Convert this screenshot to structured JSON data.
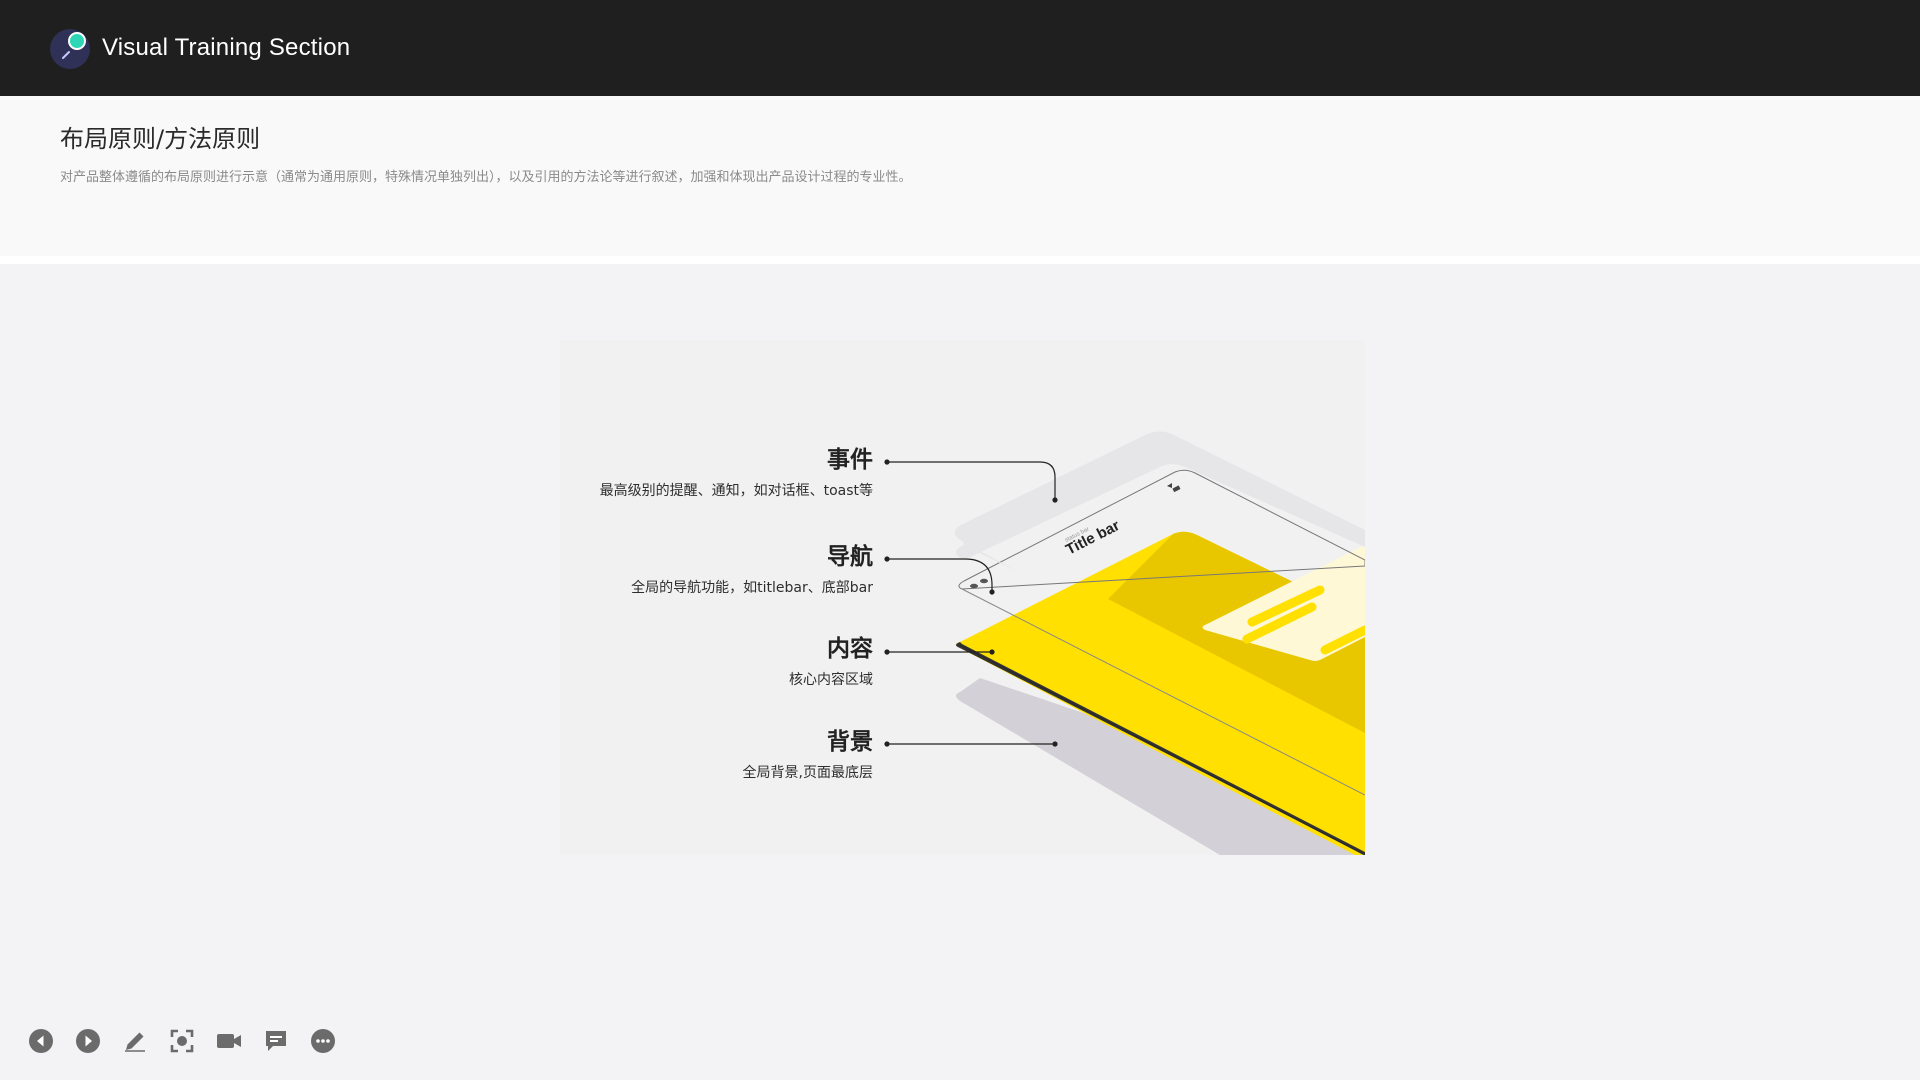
{
  "app": {
    "title": "Visual Training Section"
  },
  "header": {
    "title": "布局原则/方法原则",
    "description": "对产品整体遵循的布局原则进行示意（通常为通用原则，特殊情况单独列出），以及引用的方法论等进行叙述，加强和体现出产品设计过程的专业性。"
  },
  "diagram": {
    "layers": [
      {
        "title": "事件",
        "desc": "最高级别的提醒、通知，如对话框、toast等"
      },
      {
        "title": "导航",
        "desc": "全局的导航功能，如titlebar、底部bar"
      },
      {
        "title": "内容",
        "desc": "核心内容区域"
      },
      {
        "title": "背景",
        "desc": "全局背景,页面最底层"
      }
    ],
    "titlebar_label": "Title bar",
    "status_label": "status bar"
  },
  "toolbar": {
    "items": [
      {
        "name": "prev-slide",
        "icon": "arrow-left-circle-icon"
      },
      {
        "name": "next-slide",
        "icon": "arrow-right-circle-icon"
      },
      {
        "name": "pen",
        "icon": "pencil-icon"
      },
      {
        "name": "screenshot",
        "icon": "focus-frame-icon"
      },
      {
        "name": "camera",
        "icon": "video-camera-icon"
      },
      {
        "name": "comments",
        "icon": "chat-bubble-icon"
      },
      {
        "name": "more",
        "icon": "more-dots-icon"
      }
    ]
  },
  "colors": {
    "topbar": "#1f1f1f",
    "accent_yellow": "#ffe000",
    "icon_gray": "#6b6b6b"
  }
}
